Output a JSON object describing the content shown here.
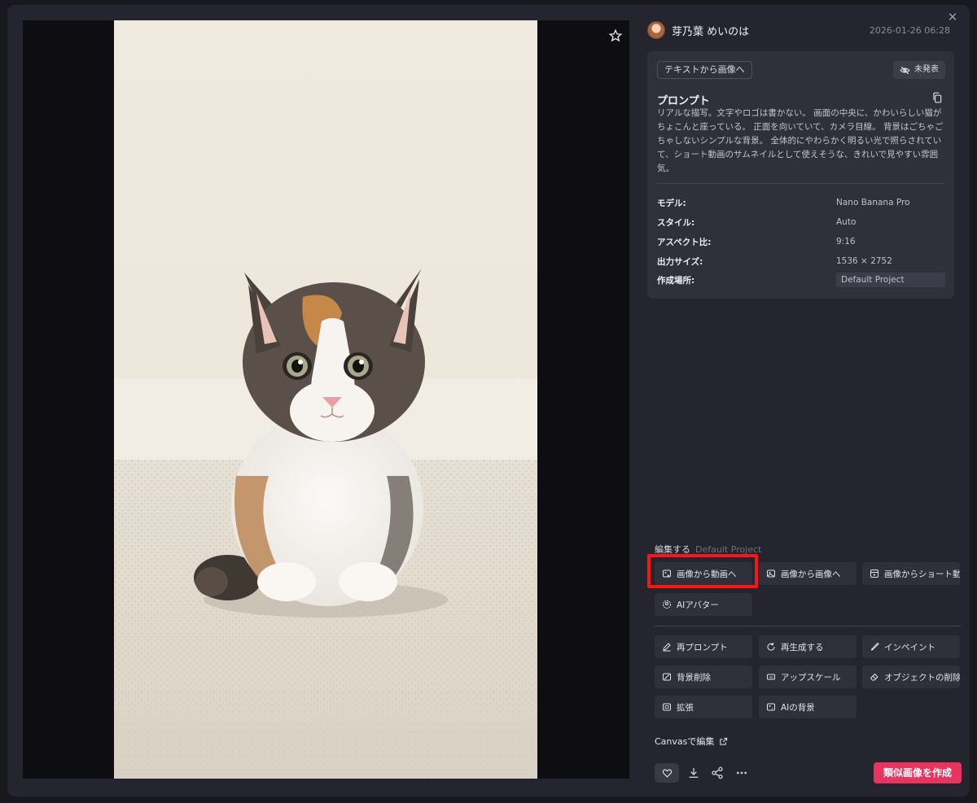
{
  "header": {
    "username": "芽乃葉 めいのは",
    "date": "2026-01-26 06:28",
    "close_icon": "close-icon"
  },
  "image": {
    "alt": "kitten photo",
    "favorite_icon": "star-icon"
  },
  "info": {
    "mode_chip": "テキストから画像へ",
    "visibility_chip": "未発表",
    "prompt_heading": "プロンプト",
    "prompt_text": "リアルな描写。文字やロゴは書かない。 画面の中央に、かわいらしい猫がちょこんと座っている。 正面を向いていて、カメラ目線。 背景はごちゃごちゃしないシンプルな背景。 全体的にやわらかく明るい光で照らされていて、ショート動画のサムネイルとして使えそうな、きれいで見やすい雰囲気。",
    "meta": [
      {
        "label": "モデル:",
        "value": "Nano Banana Pro"
      },
      {
        "label": "スタイル:",
        "value": "Auto"
      },
      {
        "label": "アスペクト比:",
        "value": "9:16"
      },
      {
        "label": "出力サイズ:",
        "value": "1536 × 2752"
      },
      {
        "label": "作成場所:",
        "value": "Default Project"
      }
    ]
  },
  "edit": {
    "heading": "編集する",
    "project": "Default Project",
    "primary": [
      {
        "label": "画像から動画へ",
        "icon": "image-to-video-icon"
      },
      {
        "label": "画像から画像へ",
        "icon": "image-to-image-icon"
      },
      {
        "label": "画像からショート動画へ",
        "icon": "short-video-icon"
      },
      {
        "label": "AIアバター",
        "icon": "avatar-icon"
      }
    ],
    "tools": [
      {
        "label": "再プロンプト",
        "icon": "pencil-icon"
      },
      {
        "label": "再生成する",
        "icon": "refresh-icon"
      },
      {
        "label": "インペイント",
        "icon": "brush-icon"
      },
      {
        "label": "背景削除",
        "icon": "background-remove-icon"
      },
      {
        "label": "アップスケール",
        "icon": "upscale-icon"
      },
      {
        "label": "オブジェクトの削除",
        "icon": "eraser-icon"
      },
      {
        "label": "拡張",
        "icon": "expand-icon"
      },
      {
        "label": "AIの背景",
        "icon": "ai-background-icon"
      }
    ],
    "canvas_link": "Canvasで編集"
  },
  "footer": {
    "create_similar": "類似画像を作成"
  },
  "colors": {
    "accent": "#e8345f",
    "highlight": "#ff1414",
    "panel": "#25252f",
    "card": "#30303b"
  }
}
